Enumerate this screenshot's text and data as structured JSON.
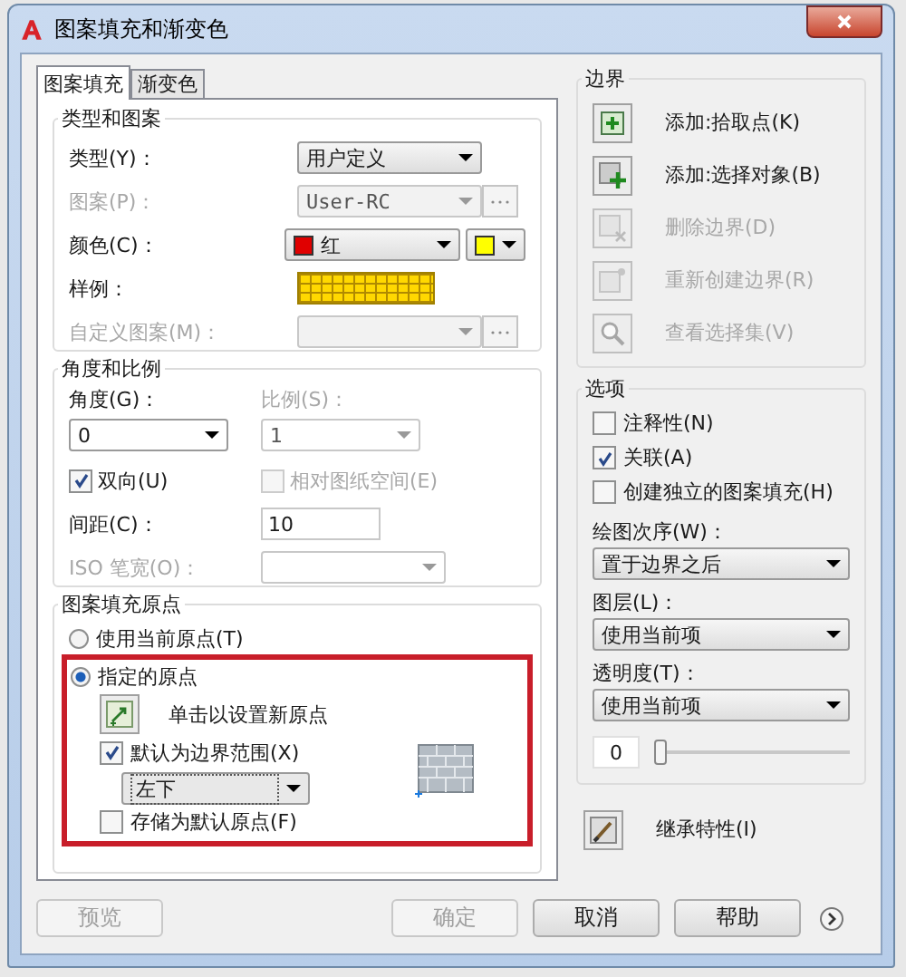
{
  "window": {
    "title": "图案填充和渐变色"
  },
  "tabs": [
    {
      "label": "图案填充",
      "selected": true
    },
    {
      "label": "渐变色",
      "selected": false
    }
  ],
  "type_and_pattern": {
    "title": "类型和图案",
    "rows": [
      {
        "kind": "dropdown",
        "label": "类型(Y)：",
        "value": "用户定义",
        "disabled": false
      },
      {
        "kind": "dropdown",
        "label": "图案(P)：",
        "value": "User-RC",
        "disabled": true,
        "browse": true
      },
      {
        "kind": "color",
        "label": "颜色(C)：",
        "value": "红",
        "swatches": [
          {
            "color": "#e00000"
          },
          {
            "color": "#ffff00"
          }
        ],
        "disabled": false
      },
      {
        "kind": "sample",
        "label": "样例：",
        "disabled": false
      },
      {
        "kind": "dropdown",
        "label": "自定义图案(M)：",
        "disabled": true,
        "browse": true
      }
    ]
  },
  "angle_and_scale": {
    "title": "角度和比例",
    "angle": {
      "label": "角度(G)：",
      "value": "0",
      "disabled": false
    },
    "scale": {
      "label": "比例(S)：",
      "value": "1",
      "disabled": true
    },
    "checks": [
      {
        "label": "双向(U)",
        "checked": true,
        "disabled": false
      },
      {
        "label": "相对图纸空间(E)",
        "checked": false,
        "disabled": true
      }
    ],
    "spacing": {
      "label": "间距(C)：",
      "value": "10",
      "disabled": false
    },
    "iso_pen": {
      "label": "ISO 笔宽(O)：",
      "disabled": true
    }
  },
  "origin": {
    "title": "图案填充原点",
    "highlighted": true,
    "radios": [
      {
        "label": "使用当前原点(T)",
        "selected": false
      },
      {
        "label": "指定的原点",
        "selected": true
      }
    ],
    "set_origin": "单击以设置新原点",
    "default_extent": {
      "label": "默认为边界范围(X)",
      "checked": true
    },
    "position": "左下",
    "store_default": {
      "label": "存储为默认原点(F)",
      "checked": false
    }
  },
  "boundaries": {
    "title": "边界",
    "buttons": [
      {
        "kind": "pick",
        "label": "添加:拾取点(K)",
        "disabled": false
      },
      {
        "kind": "select",
        "label": "添加:选择对象(B)",
        "disabled": false
      },
      {
        "kind": "remove",
        "label": "删除边界(D)",
        "disabled": true
      },
      {
        "kind": "recreate",
        "label": "重新创建边界(R)",
        "disabled": true
      },
      {
        "kind": "view",
        "label": "查看选择集(V)",
        "disabled": true
      }
    ]
  },
  "options": {
    "title": "选项",
    "checks": [
      {
        "label": "注释性(N)",
        "checked": false
      },
      {
        "label": "关联(A)",
        "checked": true
      },
      {
        "label": "创建独立的图案填充(H)",
        "checked": false
      }
    ],
    "draw_order": {
      "label": "绘图次序(W)：",
      "value": "置于边界之后"
    },
    "layer": {
      "label": "图层(L)：",
      "value": "使用当前项"
    },
    "transparency": {
      "label": "透明度(T)：",
      "value": "使用当前项",
      "amount": "0",
      "level": 0
    }
  },
  "inherit": "继承特性(I)",
  "footer": [
    {
      "label": "预览",
      "disabled": true
    },
    {
      "label": "确定",
      "disabled": true
    },
    {
      "label": "取消",
      "disabled": false
    },
    {
      "label": "帮助",
      "disabled": false
    }
  ]
}
